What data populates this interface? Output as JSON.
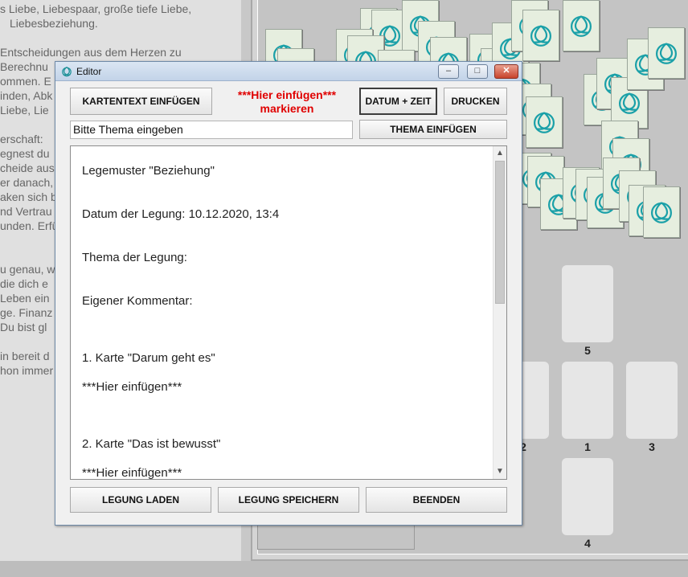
{
  "background_text": [
    "s Liebe, Liebespaar, große tiefe Liebe,",
    "Liebesbeziehung.",
    "Entscheidungen aus dem Herzen zu",
    "Berechnu",
    "ommen. E",
    "inden, Abk",
    "Liebe, Lie",
    "erschaft:",
    "egnest du",
    "cheide aus",
    "er danach,",
    "aken sich b",
    "nd Vertrau",
    "unden. Erfü",
    "u genau, w",
    "die dich e",
    "Leben ein",
    "ge. Finanz",
    "Du bist gl",
    "in bereit d",
    "hon immer"
  ],
  "slots": [
    {
      "label": "5"
    },
    {
      "label": "2"
    },
    {
      "label": "1"
    },
    {
      "label": "3"
    },
    {
      "label": "4"
    }
  ],
  "window": {
    "title": "Editor",
    "minimize": "–",
    "maximize": "□",
    "close": "✕"
  },
  "toolbar": {
    "insert_card_text": "KARTENTEXT EINFÜGEN",
    "hint_line1": "***Hier einfügen***",
    "hint_line2": "markieren",
    "date_time": "DATUM + ZEIT",
    "print": "DRUCKEN",
    "insert_theme": "THEMA EINFÜGEN"
  },
  "theme_input": {
    "value": "Bitte Thema eingeben"
  },
  "editor_text": [
    "Legemuster \"Beziehung\"",
    "Datum der Legung: 10.12.2020, 13:4",
    "Thema der Legung:",
    "Eigener Kommentar:",
    "1. Karte \"Darum geht es\"",
    "***Hier einfügen***",
    "2. Karte \"Das ist bewusst\"",
    "***Hier einfügen***"
  ],
  "footer": {
    "load": "LEGUNG LADEN",
    "save": "LEGUNG SPEICHERN",
    "quit": "BEENDEN"
  },
  "colors": {
    "hint": "#e00000",
    "card_symbol": "#1aa0a8",
    "card_face": "#e6eedf"
  },
  "icons": {
    "card_symbol": "triquetra-icon",
    "window_icon": "triquetra-icon"
  }
}
